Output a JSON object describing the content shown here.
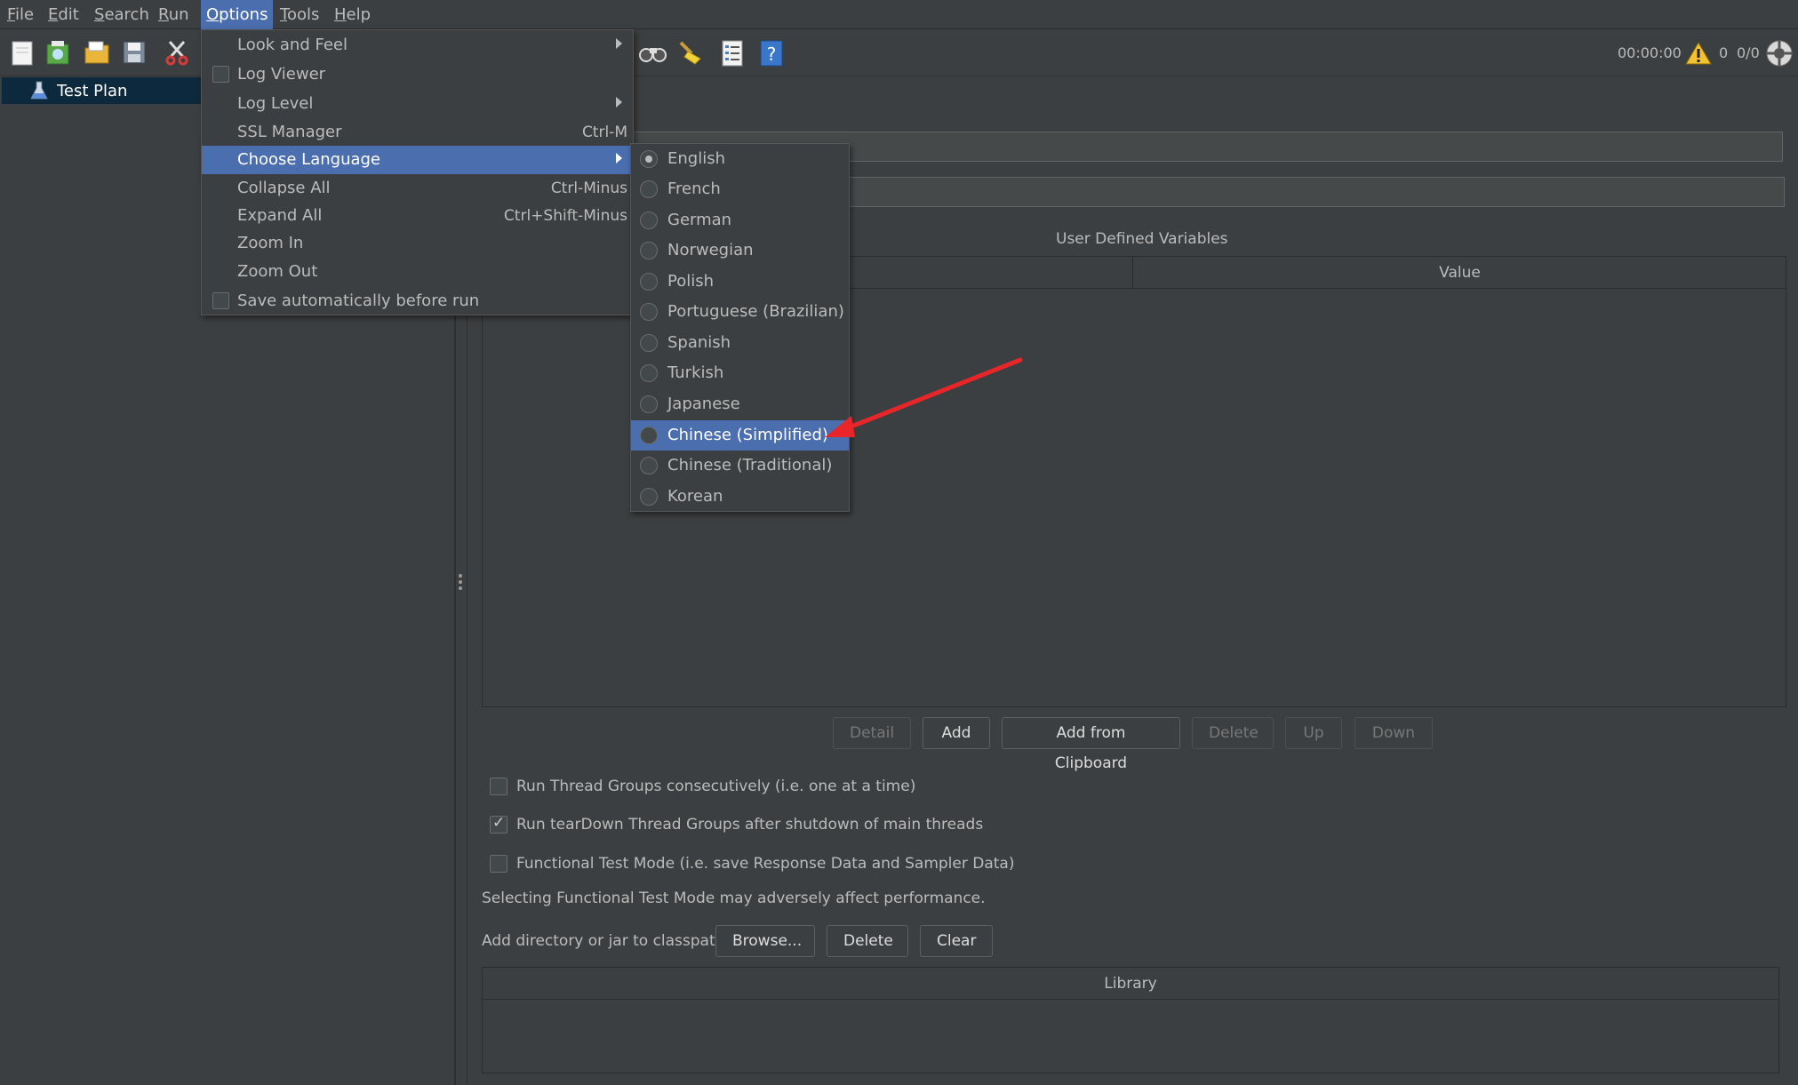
{
  "menubar": {
    "items": [
      "File",
      "Edit",
      "Search",
      "Run",
      "Options",
      "Tools",
      "Help"
    ],
    "active": "Options"
  },
  "toolbar": {
    "icons": [
      "new-icon",
      "templates-icon",
      "open-icon",
      "save-icon",
      "cut-icon",
      "search-icon",
      "clear-icon",
      "function-helper-icon",
      "help-icon"
    ],
    "timer": "00:00:00",
    "warning_count": "0",
    "threads": "0/0"
  },
  "tree": {
    "root": "Test Plan"
  },
  "options_menu": {
    "items": [
      {
        "label": "Look and Feel",
        "type": "submenu"
      },
      {
        "label": "Log Viewer",
        "type": "check",
        "checked": false
      },
      {
        "label": "Log Level",
        "type": "submenu"
      },
      {
        "label": "SSL Manager",
        "type": "item",
        "shortcut": "Ctrl-M"
      },
      {
        "label": "Choose Language",
        "type": "submenu",
        "highlighted": true
      },
      {
        "label": "Collapse All",
        "type": "item",
        "shortcut": "Ctrl-Minus"
      },
      {
        "label": "Expand All",
        "type": "item",
        "shortcut": "Ctrl+Shift-Minus"
      },
      {
        "label": "Zoom In",
        "type": "item"
      },
      {
        "label": "Zoom Out",
        "type": "item"
      },
      {
        "label": "Save automatically before run",
        "type": "check",
        "checked": false
      }
    ]
  },
  "language_menu": {
    "items": [
      {
        "label": "English",
        "selected": true
      },
      {
        "label": "French"
      },
      {
        "label": "German"
      },
      {
        "label": "Norwegian"
      },
      {
        "label": "Polish"
      },
      {
        "label": "Portuguese (Brazilian)"
      },
      {
        "label": "Spanish"
      },
      {
        "label": "Turkish"
      },
      {
        "label": "Japanese"
      },
      {
        "label": "Chinese (Simplified)",
        "highlighted": true
      },
      {
        "label": "Chinese (Traditional)"
      },
      {
        "label": "Korean"
      }
    ]
  },
  "test_plan": {
    "udv_title": "User Defined Variables",
    "udv_columns": [
      "Value"
    ],
    "buttons": {
      "detail": "Detail",
      "add": "Add",
      "add_from_clipboard": "Add from Clipboard",
      "delete": "Delete",
      "up": "Up",
      "down": "Down"
    },
    "checkboxes": [
      {
        "label": "Run Thread Groups consecutively (i.e. one at a time)",
        "checked": false
      },
      {
        "label": "Run tearDown Thread Groups after shutdown of main threads",
        "checked": true
      },
      {
        "label": "Functional Test Mode (i.e. save Response Data and Sampler Data)",
        "checked": false
      }
    ],
    "functional_note": "Selecting Functional Test Mode may adversely affect performance.",
    "classpath_label": "Add directory or jar to classpath",
    "classpath_buttons": {
      "browse": "Browse...",
      "delete": "Delete",
      "clear": "Clear"
    },
    "library_column": "Library"
  },
  "colors": {
    "background": "#3c3f41",
    "highlight": "#4b6eaf",
    "annotation_arrow": "#e8262a"
  }
}
